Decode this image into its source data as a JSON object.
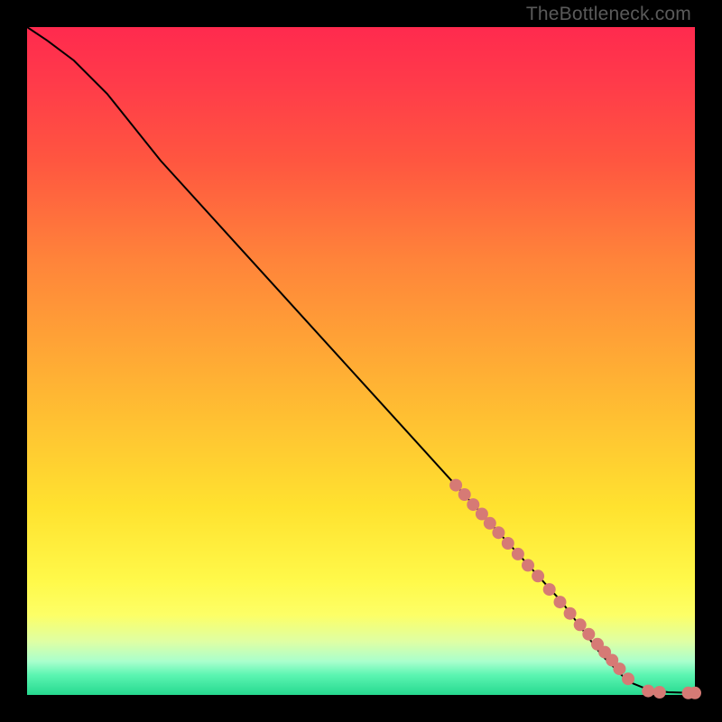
{
  "watermark": "TheBottleneck.com",
  "colors": {
    "page_bg": "#000000",
    "dot": "#d67a75",
    "curve": "#000000",
    "gradient_top": "#ff2a4e",
    "gradient_mid": "#ffe22f",
    "gradient_bottom": "#26d98f"
  },
  "chart_data": {
    "type": "line",
    "title": "",
    "xlabel": "",
    "ylabel": "",
    "xlim": [
      0,
      100
    ],
    "ylim": [
      0,
      100
    ],
    "grid": false,
    "axes_visible": false,
    "series": [
      {
        "name": "curve",
        "style": "solid-black",
        "x": [
          0,
          3,
          7,
          12,
          20,
          30,
          40,
          50,
          60,
          70,
          80,
          86,
          90,
          93,
          96,
          100
        ],
        "y": [
          100,
          98,
          95,
          90,
          80,
          69,
          58,
          47,
          36,
          25,
          14,
          6,
          2,
          0.8,
          0.4,
          0.3
        ]
      },
      {
        "name": "dots",
        "style": "salmon-dots",
        "x": [
          64.2,
          65.5,
          66.8,
          68.1,
          69.3,
          70.6,
          72.0,
          73.5,
          75.0,
          76.5,
          78.2,
          79.8,
          81.3,
          82.8,
          84.1,
          85.4,
          86.5,
          87.6,
          88.7,
          90.0,
          93.0,
          94.7,
          99.0,
          100.0
        ],
        "y": [
          31.4,
          30.0,
          28.5,
          27.1,
          25.7,
          24.3,
          22.7,
          21.1,
          19.4,
          17.8,
          15.8,
          13.9,
          12.2,
          10.5,
          9.1,
          7.6,
          6.4,
          5.2,
          3.9,
          2.4,
          0.6,
          0.4,
          0.3,
          0.3
        ]
      }
    ]
  }
}
